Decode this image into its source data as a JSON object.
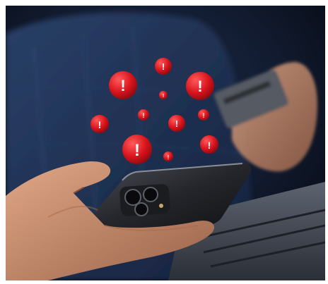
{
  "scene": {
    "subject": "person holding smartphone and credit card",
    "alert_symbol": "!",
    "colors": {
      "background": "#0b0f1a",
      "shirt": "#22355a",
      "alert_red": "#d8141d",
      "alert_highlight": "#ff5a5a",
      "phone_body": "#2a2c31",
      "skin": "#c58c6e"
    }
  }
}
